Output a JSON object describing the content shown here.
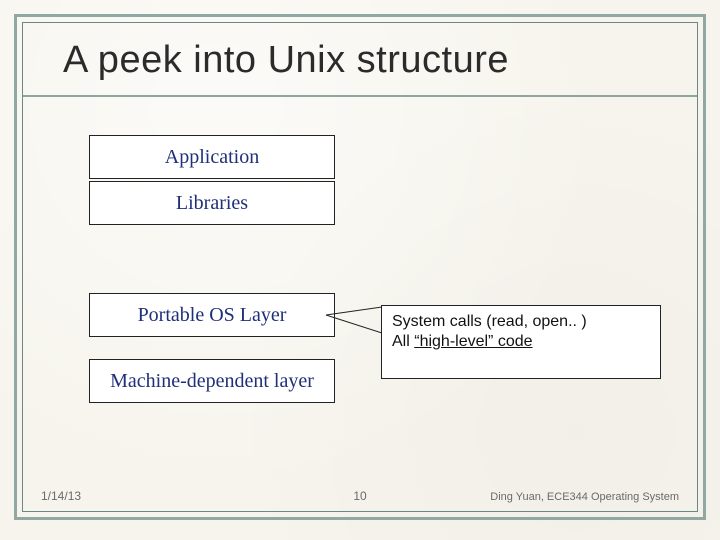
{
  "slide": {
    "title": "A peek into Unix structure",
    "boxes": {
      "application": "Application",
      "libraries": "Libraries",
      "portable_os_layer": "Portable OS Layer",
      "machine_dependent_layer": "Machine-dependent layer"
    },
    "callout": {
      "line1": "System calls (read, open.. )",
      "line2_prefix": "All ",
      "line2_quoted": "“high-level” code"
    },
    "footer": {
      "date": "1/14/13",
      "page": "10",
      "credit": "Ding Yuan, ECE344 Operating System"
    },
    "colors": {
      "frame": "#8fa8a3",
      "box_text": "#1f2f78"
    }
  }
}
